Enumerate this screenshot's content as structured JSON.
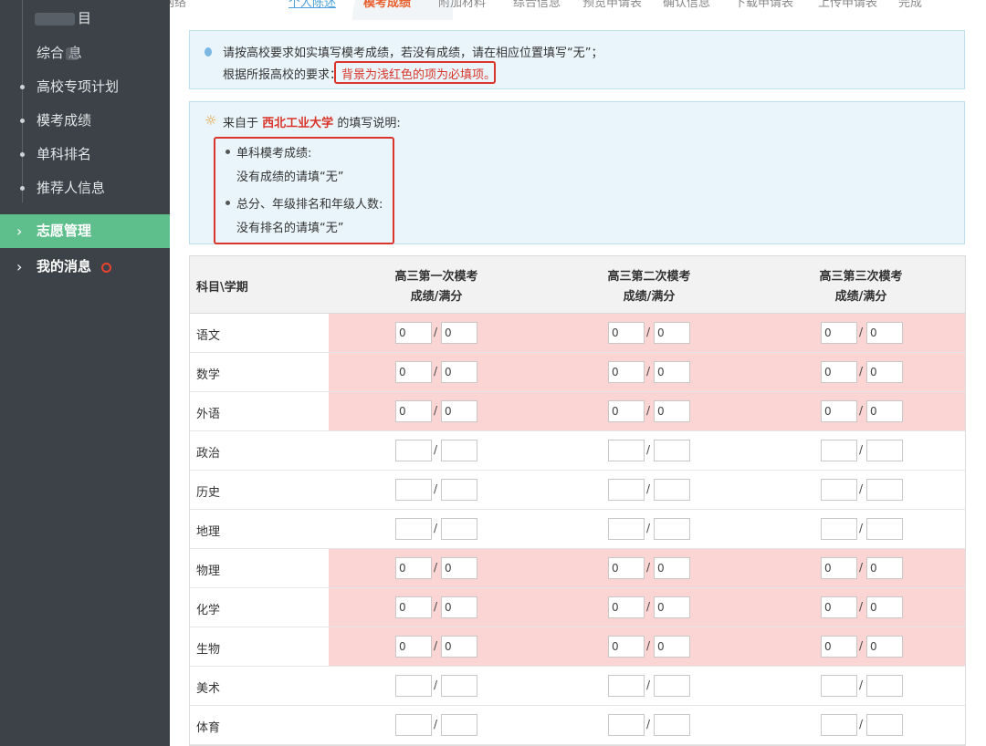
{
  "sidebar": {
    "sub_items": [
      {
        "label": "目"
      },
      {
        "label": "综合 息"
      },
      {
        "label": "高校专项计划"
      },
      {
        "label": "模考成绩"
      },
      {
        "label": "单科排名"
      },
      {
        "label": "推荐人信息"
      }
    ],
    "main_items": [
      {
        "label": "志愿管理",
        "icon": "chevron-right-icon",
        "active": true
      },
      {
        "label": "我的消息",
        "icon": "chevron-right-icon",
        "badge_color": "#e8432e"
      }
    ]
  },
  "tabs": [
    {
      "label": "个人陈述",
      "state": "done"
    },
    {
      "label": "模考成绩",
      "state": "current"
    },
    {
      "label": "附加材料"
    },
    {
      "label": "综合信息"
    },
    {
      "label": "预览申请表"
    },
    {
      "label": "确认信息"
    },
    {
      "label": "下载申请表"
    },
    {
      "label": "上传申请表"
    },
    {
      "label": "完成"
    }
  ],
  "notice": {
    "line1": "请按高校要求如实填写模考成绩，若没有成绩，请在相应位置填写“无”；",
    "line2_prefix": "根据所报高校的要求：",
    "line2_highlight": "背景为浅红色的项为必填项。"
  },
  "instructions": {
    "prefix": "来自于",
    "school": "西北工业大学",
    "suffix": "的填写说明:",
    "items": [
      {
        "title": "单科模考成绩:",
        "detail": "没有成绩的请填“无”"
      },
      {
        "title": "总分、年级排名和年级人数:",
        "detail": "没有排名的请填“无”"
      }
    ]
  },
  "table": {
    "subject_header": "科目\\学期",
    "columns": [
      {
        "line1": "高三第一次模考",
        "line2": "成绩/满分"
      },
      {
        "line1": "高三第二次模考",
        "line2": "成绩/满分"
      },
      {
        "line1": "高三第三次模考",
        "line2": "成绩/满分"
      }
    ],
    "rows": [
      {
        "subject": "语文",
        "required": true,
        "score": "0",
        "full": "0"
      },
      {
        "subject": "数学",
        "required": true,
        "score": "0",
        "full": "0"
      },
      {
        "subject": "外语",
        "required": true,
        "score": "0",
        "full": "0"
      },
      {
        "subject": "政治",
        "required": false,
        "score": "",
        "full": ""
      },
      {
        "subject": "历史",
        "required": false,
        "score": "",
        "full": ""
      },
      {
        "subject": "地理",
        "required": false,
        "score": "",
        "full": ""
      },
      {
        "subject": "物理",
        "required": true,
        "score": "0",
        "full": "0"
      },
      {
        "subject": "化学",
        "required": true,
        "score": "0",
        "full": "0"
      },
      {
        "subject": "生物",
        "required": true,
        "score": "0",
        "full": "0"
      },
      {
        "subject": "美术",
        "required": false,
        "score": "",
        "full": ""
      },
      {
        "subject": "体育",
        "required": false,
        "score": "",
        "full": ""
      }
    ],
    "slash": "/"
  },
  "colors": {
    "sidebar_bg": "#3c4247",
    "active_menu": "#5fbf8c",
    "required_bg": "#fbd4d4",
    "highlight_red": "#d9352a",
    "info_bg": "#eaf5fb"
  }
}
